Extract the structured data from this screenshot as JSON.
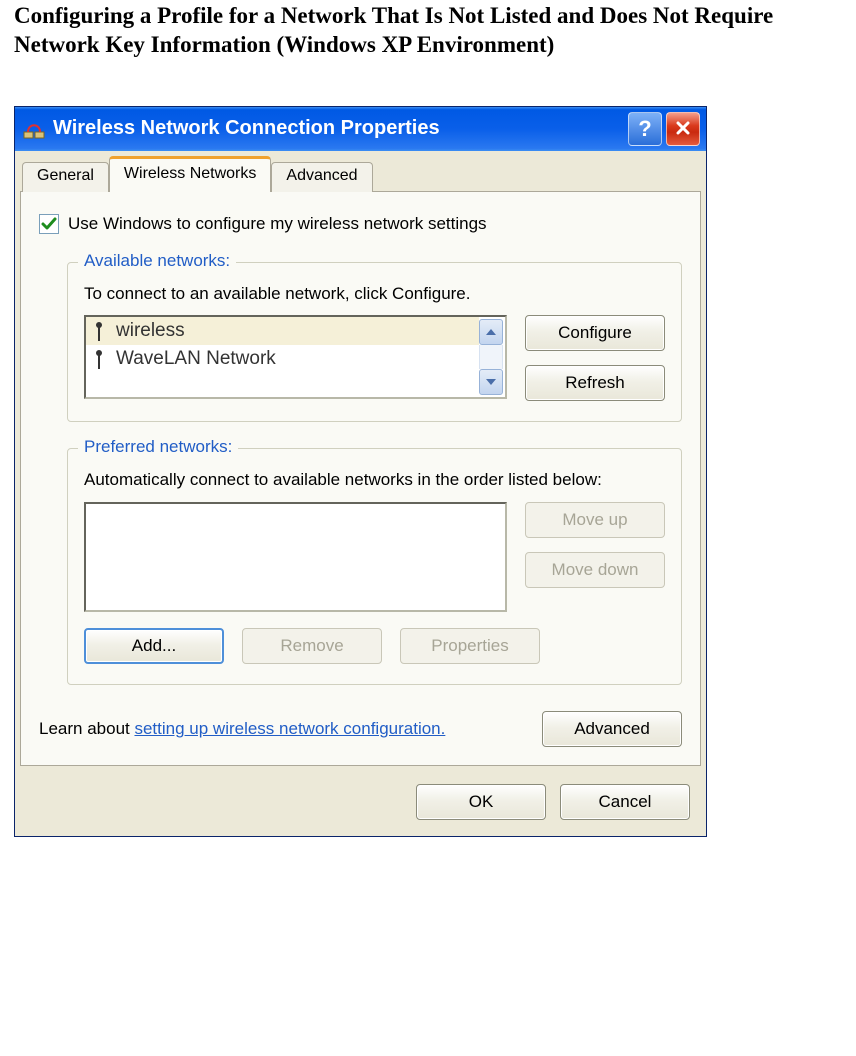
{
  "page": {
    "heading": "Configuring a Profile for a Network That Is Not Listed and Does Not Require Network Key Information (Windows XP Environment)"
  },
  "dialog": {
    "title": "Wireless Network Connection Properties",
    "tabs": {
      "general": "General",
      "wireless": "Wireless Networks",
      "advanced": "Advanced"
    },
    "checkbox": {
      "label": "Use Windows to configure my wireless network settings"
    },
    "available": {
      "legend": "Available networks:",
      "desc": "To connect to an available network, click Configure.",
      "items": [
        "wireless",
        "WaveLAN Network"
      ],
      "buttons": {
        "configure": "Configure",
        "refresh": "Refresh"
      }
    },
    "preferred": {
      "legend": "Preferred networks:",
      "desc": "Automatically connect to available networks in the order listed below:",
      "buttons": {
        "moveup": "Move up",
        "movedown": "Move down",
        "add": "Add...",
        "remove": "Remove",
        "properties": "Properties"
      }
    },
    "learn": {
      "prefix": "Learn about ",
      "link": "setting up wireless network configuration."
    },
    "advanced_btn": "Advanced",
    "footer": {
      "ok": "OK",
      "cancel": "Cancel"
    }
  }
}
